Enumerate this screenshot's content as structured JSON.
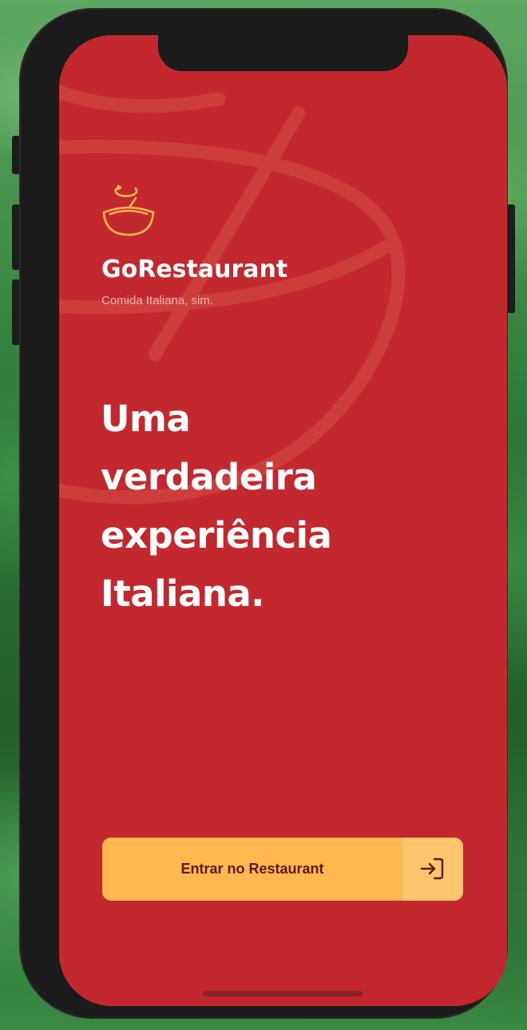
{
  "app": {
    "name": "GoRestaurant",
    "tagline": "Comida Italiana, sim."
  },
  "hero": {
    "lines": [
      "Uma",
      "verdadeira",
      "experiência",
      "Italiana."
    ]
  },
  "enter_button": {
    "label": "Entrar no Restaurant",
    "icon": "log-in-icon"
  },
  "colors": {
    "screen_background": "#c3282e",
    "button_background": "#ffb84d",
    "button_icon_background": "#ffc56d",
    "button_text": "#5b1a1e",
    "logo_accent": "#ffb84d",
    "primary_text": "#ffffff"
  }
}
